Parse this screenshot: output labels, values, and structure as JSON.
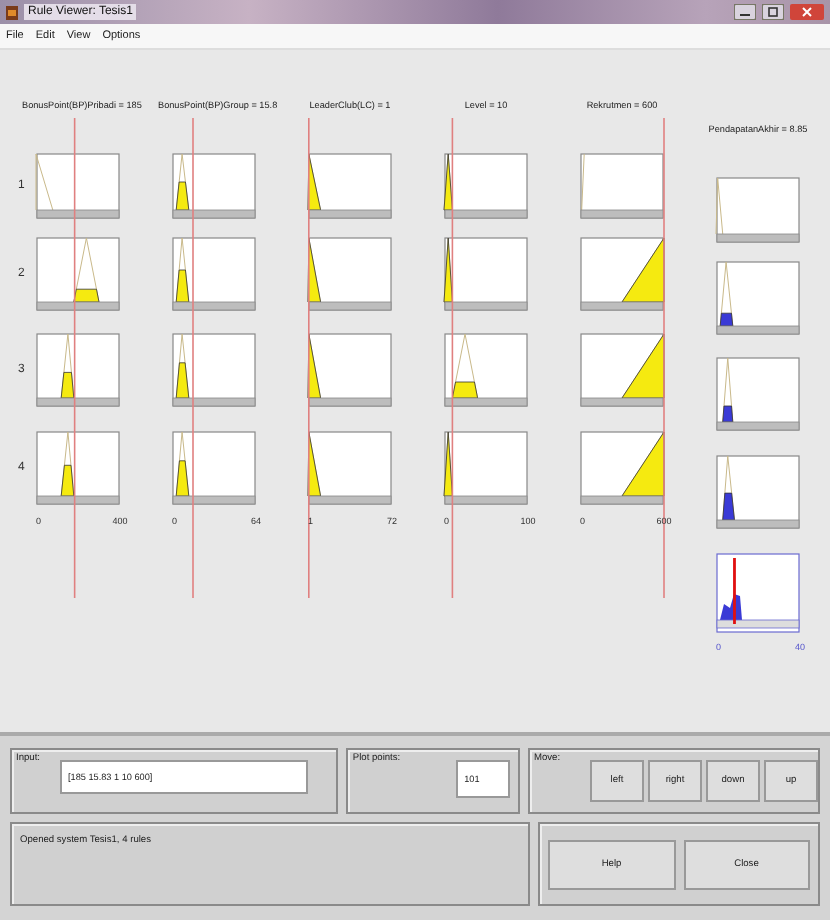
{
  "window": {
    "title": "Rule Viewer: Tesis1"
  },
  "menu": [
    "File",
    "Edit",
    "View",
    "Options"
  ],
  "rules": [
    "1",
    "2",
    "3",
    "4"
  ],
  "inputs": [
    {
      "label": "BonusPoint(BP)Pribadi = 185",
      "ticks": [
        "0",
        "400"
      ]
    },
    {
      "label": "BonusPoint(BP)Group = 15.8",
      "ticks": [
        "0",
        "64"
      ]
    },
    {
      "label": "LeaderClub(LC) = 1",
      "ticks": [
        "1",
        "72"
      ]
    },
    {
      "label": "Level = 10",
      "ticks": [
        "0",
        "100"
      ]
    },
    {
      "label": "Rekrutmen = 600",
      "ticks": [
        "0",
        "600"
      ]
    }
  ],
  "output": {
    "label": "PendapatanAkhir = 8.85",
    "ticks": [
      "0",
      "40"
    ]
  },
  "input_field": {
    "label": "Input:",
    "value": "[185 15.83 1 10 600]"
  },
  "plot_points": {
    "label": "Plot points:",
    "value": "101"
  },
  "move": {
    "label": "Move:",
    "buttons": [
      "left",
      "right",
      "down",
      "up"
    ]
  },
  "status": "Opened system Tesis1, 4 rules",
  "buttons": [
    "Help",
    "Close"
  ]
}
